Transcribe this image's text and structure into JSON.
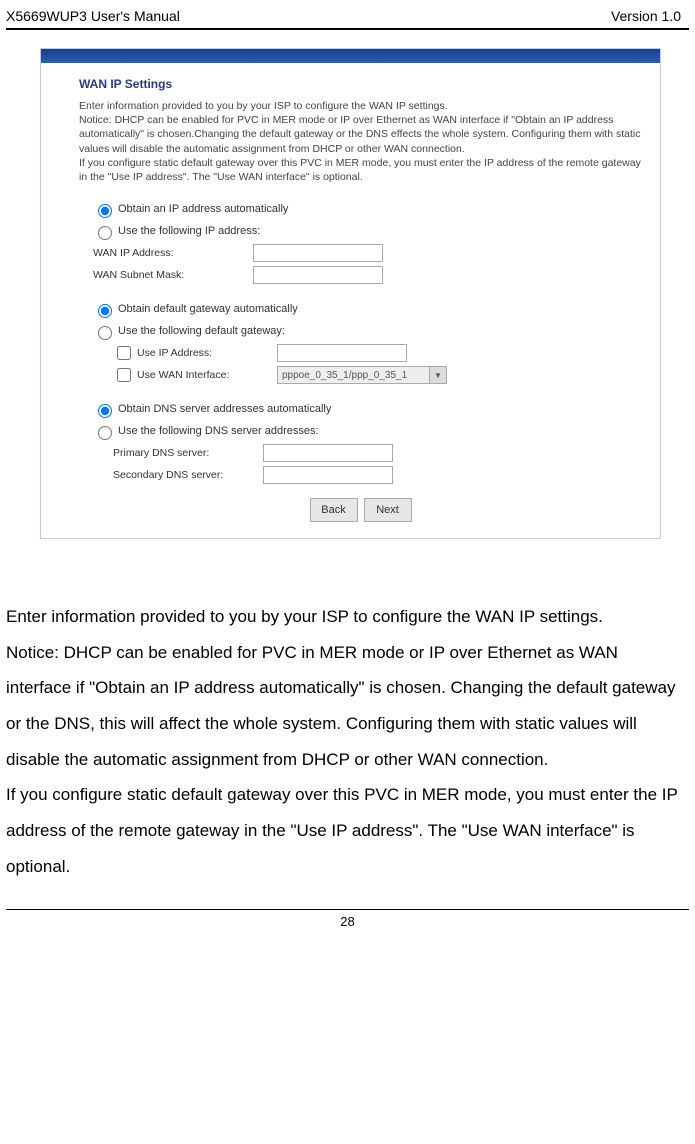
{
  "header": {
    "left": "X5669WUP3 User's Manual",
    "right": "Version 1.0"
  },
  "panel": {
    "title": "WAN IP Settings",
    "desc": "Enter information provided to you by your ISP to configure the WAN IP settings.\nNotice: DHCP can be enabled for PVC in MER mode or IP over Ethernet as WAN interface if \"Obtain an IP address automatically\" is chosen.Changing the default gateway or the DNS effects the whole system. Configuring them with static values will disable the automatic assignment from DHCP or other WAN connection.\nIf you configure static default gateway over this PVC in MER mode, you must enter the IP address of the remote gateway in the \"Use IP address\". The \"Use WAN interface\" is optional.",
    "ip": {
      "auto": "Obtain an IP address automatically",
      "use": "Use the following IP address:",
      "wan_ip_label": "WAN IP Address:",
      "wan_mask_label": "WAN Subnet Mask:"
    },
    "gw": {
      "auto": "Obtain default gateway automatically",
      "use": "Use the following default gateway:",
      "use_ip_label": "Use IP Address:",
      "use_wan_label": "Use WAN Interface:",
      "wan_value": "pppoe_0_35_1/ppp_0_35_1"
    },
    "dns": {
      "auto": "Obtain DNS server addresses automatically",
      "use": "Use the following DNS server addresses:",
      "primary_label": "Primary DNS server:",
      "secondary_label": "Secondary DNS server:"
    },
    "buttons": {
      "back": "Back",
      "next": "Next"
    }
  },
  "body_text": "Enter information provided to you by your ISP to configure the WAN IP settings.\nNotice: DHCP can be enabled for PVC in MER mode or IP over Ethernet as WAN interface if \"Obtain an IP address automatically\" is chosen. Changing the default gateway or the DNS, this will affect the whole system. Configuring them with static values will disable the automatic assignment from DHCP or other WAN connection.\nIf you configure static default gateway over this PVC in MER mode, you must enter the IP address of the remote gateway in the \"Use IP address\". The \"Use WAN interface\" is optional.",
  "page_number": "28"
}
